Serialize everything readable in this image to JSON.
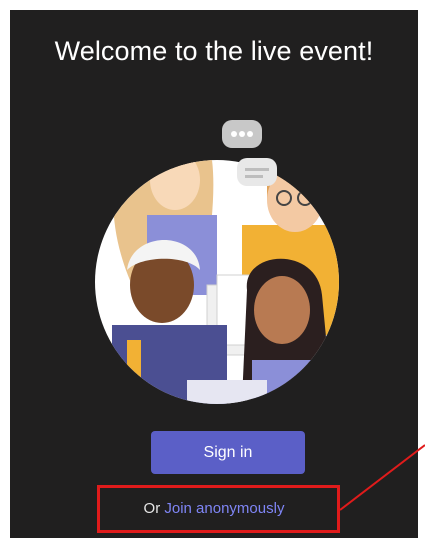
{
  "welcome": {
    "title": "Welcome to the live event!"
  },
  "actions": {
    "sign_in_label": "Sign in",
    "or_label": "Or",
    "join_anonymously_label": "Join anonymously"
  },
  "colors": {
    "background": "#201f1f",
    "primary_button": "#5b5fc7",
    "link": "#7f85f5",
    "annotation": "#e01b1b"
  },
  "icons": {
    "illustration": "people-illustration"
  }
}
